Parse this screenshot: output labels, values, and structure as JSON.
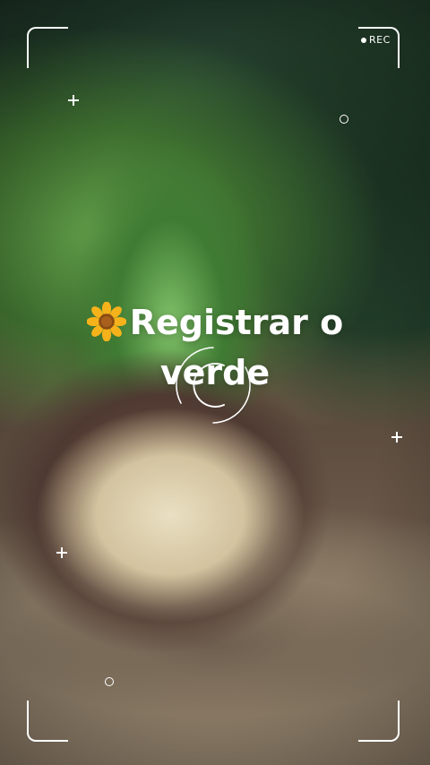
{
  "overlay": {
    "rec_label": "REC",
    "title_line1": "Registrar o",
    "title_line2": "verde",
    "title_icon": "sunflower-icon"
  },
  "colors": {
    "overlay": "#ffffff"
  }
}
